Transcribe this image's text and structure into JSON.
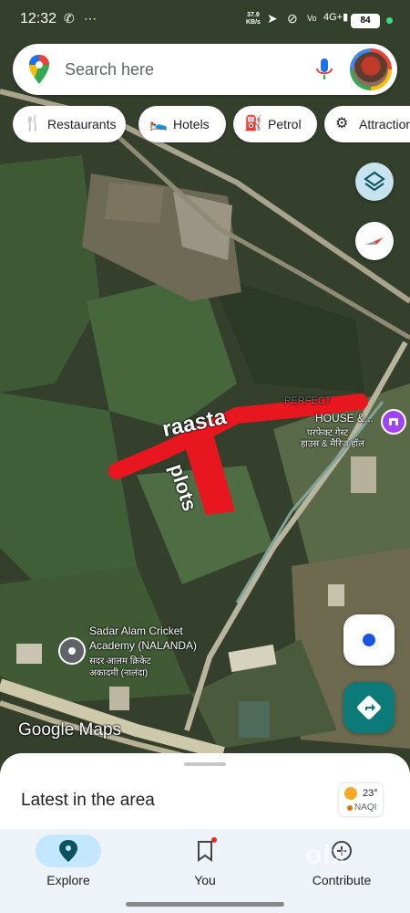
{
  "status_bar": {
    "time": "12:32",
    "net_speed_value": "37.9",
    "net_speed_unit": "KB/s",
    "battery": "84"
  },
  "search": {
    "placeholder": "Search here"
  },
  "chips": [
    {
      "label": "Restaurants",
      "icon": "fork-knife-icon"
    },
    {
      "label": "Hotels",
      "icon": "bed-icon"
    },
    {
      "label": "Petrol",
      "icon": "fuel-icon"
    },
    {
      "label": "Attractions",
      "icon": "attraction-icon"
    }
  ],
  "map": {
    "annotation_road": "raasta",
    "annotation_plots": "plots",
    "poi_marriage_house_en": "HOUSE &...",
    "poi_marriage_house_en_top": "PERFECT",
    "poi_marriage_house_hi_1": "परफेक्ट गेस्ट",
    "poi_marriage_house_hi_2": "हाउस & मैरिज हॉल",
    "poi_academy_en_1": "Sadar Alam Cricket",
    "poi_academy_en_2": "Academy (NALANDA)",
    "poi_academy_hi_1": "सदर आलम क्रिकेट",
    "poi_academy_hi_2": "अकादमी (नालंदा)",
    "brand": "Google Maps"
  },
  "sheet": {
    "title": "Latest in the area",
    "weather_temp": "23°",
    "weather_aqi": "NAQI"
  },
  "nav": {
    "explore": "Explore",
    "you": "You",
    "contribute": "Contribute"
  },
  "watermark": "olx",
  "colors": {
    "accent_teal": "#0b7a78",
    "nav_active": "#c2e7ff",
    "annotation_red": "#e8161f"
  }
}
